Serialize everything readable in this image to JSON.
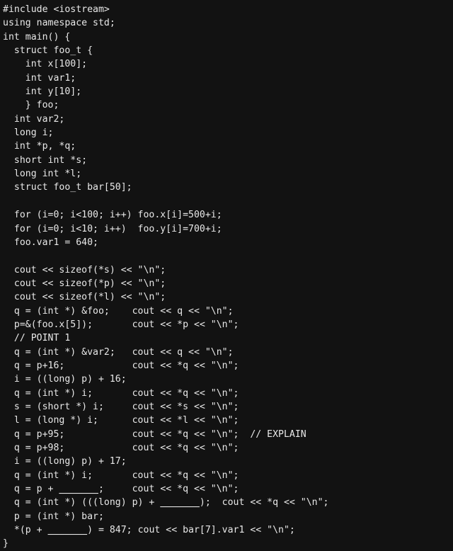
{
  "document": {
    "kind": "source-code-listing",
    "language": "cpp",
    "background_color": "#121212",
    "text_color": "#e8e8e8",
    "blank_placeholder": "_______",
    "lines": [
      "#include <iostream>",
      "using namespace std;",
      "int main() {",
      "  struct foo_t {",
      "    int x[100];",
      "    int var1;",
      "    int y[10];",
      "    } foo;",
      "  int var2;",
      "  long i;",
      "  int *p, *q;",
      "  short int *s;",
      "  long int *l;",
      "  struct foo_t bar[50];",
      "",
      "  for (i=0; i<100; i++) foo.x[i]=500+i;",
      "  for (i=0; i<10; i++)  foo.y[i]=700+i;",
      "  foo.var1 = 640;",
      "",
      "  cout << sizeof(*s) << \"\\n\";",
      "  cout << sizeof(*p) << \"\\n\";",
      "  cout << sizeof(*l) << \"\\n\";",
      "  q = (int *) &foo;    cout << q << \"\\n\";",
      "  p=&(foo.x[5]);       cout << *p << \"\\n\";",
      "  // POINT 1",
      "  q = (int *) &var2;   cout << q << \"\\n\";",
      "  q = p+16;            cout << *q << \"\\n\";",
      "  i = ((long) p) + 16;",
      "  q = (int *) i;       cout << *q << \"\\n\";",
      "  s = (short *) i;     cout << *s << \"\\n\";",
      "  l = (long *) i;      cout << *l << \"\\n\";",
      "  q = p+95;            cout << *q << \"\\n\";  // EXPLAIN",
      "  q = p+98;            cout << *q << \"\\n\";",
      "  i = ((long) p) + 17;",
      "  q = (int *) i;       cout << *q << \"\\n\";",
      "  q = p + _______;     cout << *q << \"\\n\";",
      "  q = (int *) (((long) p) + _______);  cout << *q << \"\\n\";",
      "  p = (int *) bar;",
      "  *(p + _______) = 847; cout << bar[7].var1 << \"\\n\";",
      "}"
    ]
  }
}
